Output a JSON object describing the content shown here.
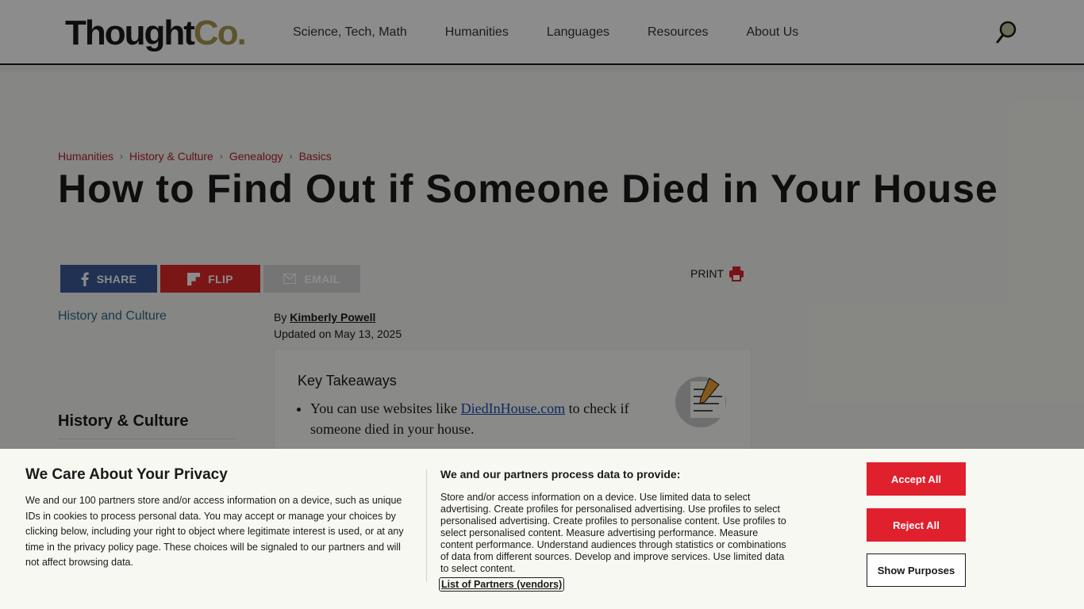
{
  "header": {
    "logo_text": "Thought",
    "logo_suffix": "Co.",
    "nav": [
      "Science, Tech, Math",
      "Humanities",
      "Languages",
      "Resources",
      "About Us"
    ]
  },
  "breadcrumb": [
    "Humanities",
    "History & Culture",
    "Genealogy",
    "Basics"
  ],
  "article": {
    "title": "How to Find Out if Someone Died in Your House",
    "share": {
      "facebook": "SHARE",
      "flip": "FLIP",
      "email": "EMAIL",
      "print": "PRINT"
    },
    "hero_alt": "History and Culture",
    "byline_prefix": "By",
    "author": "Kimberly Powell",
    "updated": "Updated on May 13, 2025",
    "sidebar_heading": "History & Culture",
    "takeaways": {
      "heading": "Key Takeaways",
      "item1_before": "You can use websites like",
      "item1_link": "DiedInHouse.com",
      "item1_after": "to check if someone died in your house."
    }
  },
  "consent": {
    "title": "We Care About Your Privacy",
    "text": "We and our 100 partners store and/or access information on a device, such as unique IDs in cookies to process personal data. You may accept or manage your choices by clicking below, including your right to object where legitimate interest is used, or at any time in the privacy policy page. These choices will be signaled to our partners and will not affect browsing data.",
    "subtitle": "We and our partners process data to provide:",
    "purposes": "Store and/or access information on a device. Use limited data to select advertising. Create profiles for personalised advertising. Use profiles to select personalised advertising. Create profiles to personalise content. Use profiles to select personalised content. Measure advertising performance. Measure content performance. Understand audiences through statistics or combinations of data from different sources. Develop and improve services. Use limited data to select content.",
    "partners_link": "List of Partners (vendors)",
    "accept": "Accept All",
    "reject": "Reject All",
    "show": "Show Purposes"
  },
  "colors": {
    "brand_red": "#e0202d",
    "logo_gold": "#a89a52",
    "facebook": "#3b5998",
    "flipboard": "#e12828"
  }
}
